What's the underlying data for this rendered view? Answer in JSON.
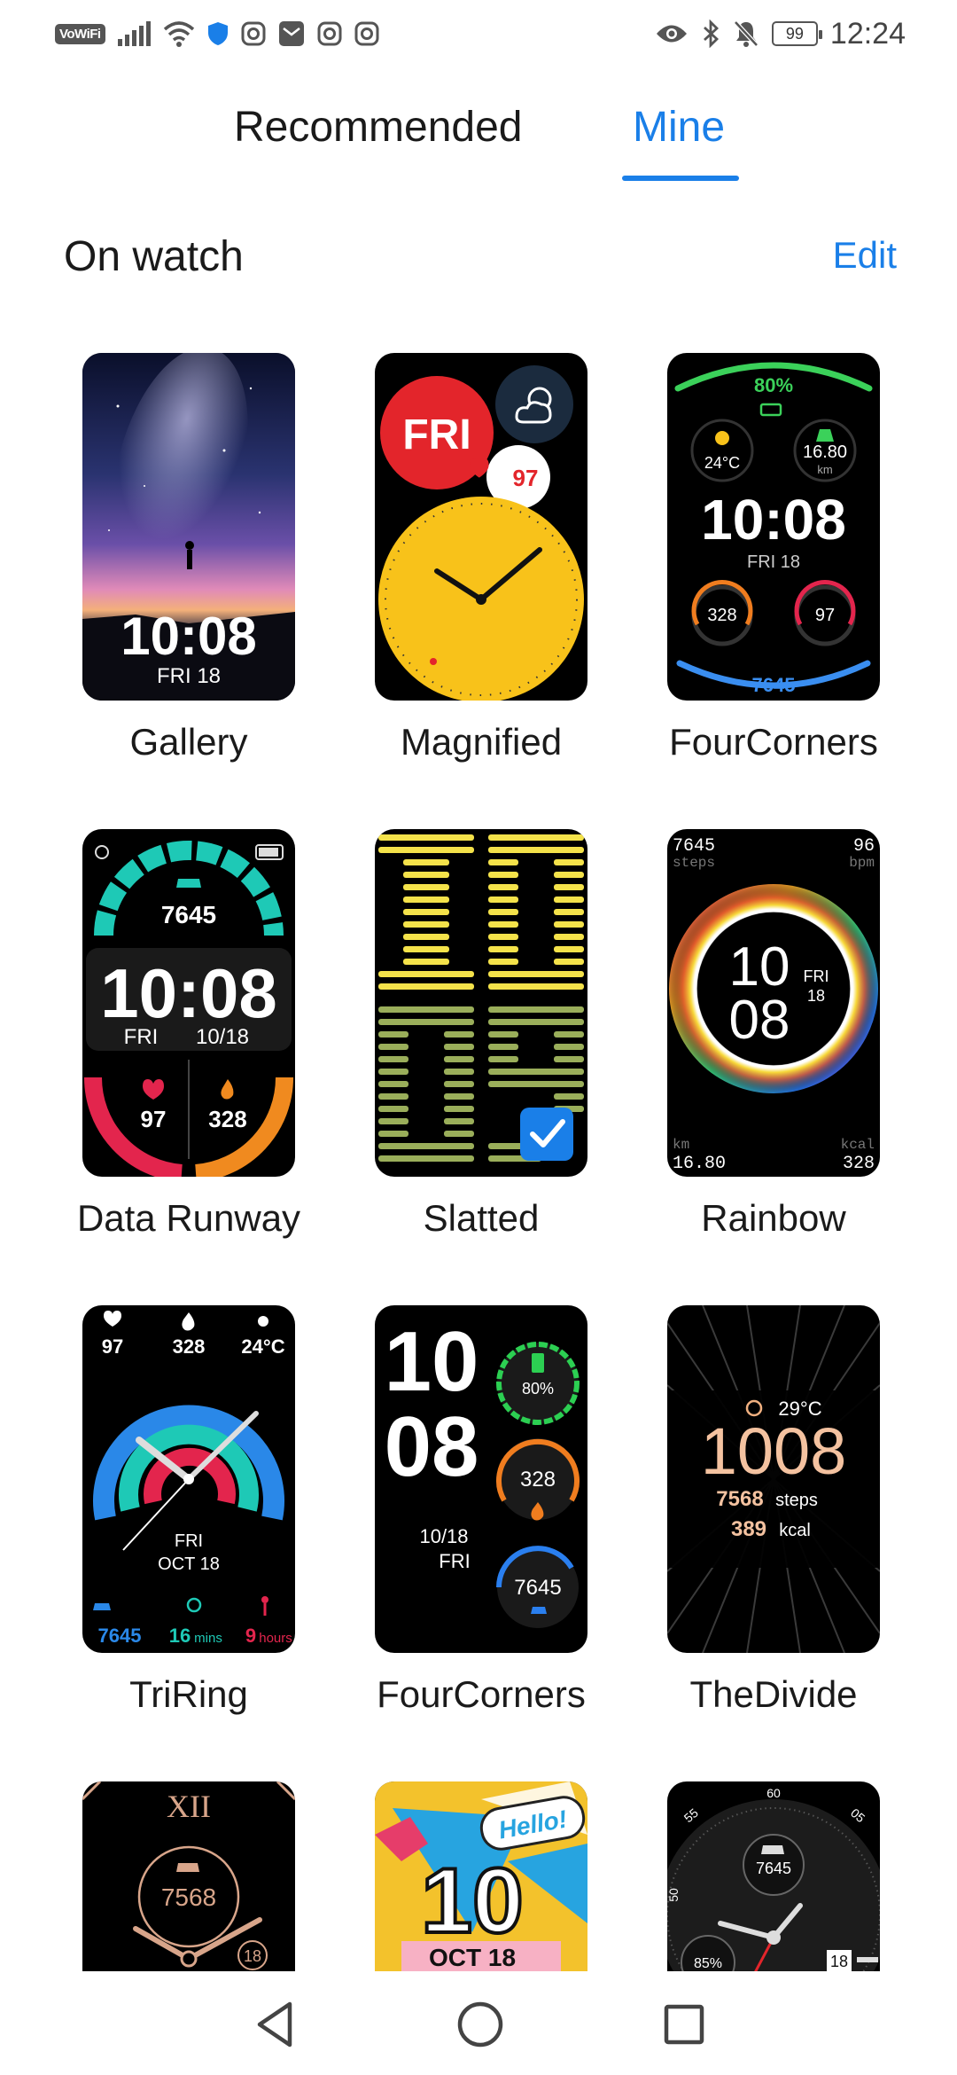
{
  "status_bar": {
    "vowifi": "VoWiFi",
    "battery": "99",
    "time": "12:24"
  },
  "tabs": [
    {
      "label": "Recommended",
      "active": false
    },
    {
      "label": "Mine",
      "active": true
    }
  ],
  "section": {
    "title": "On watch",
    "edit_label": "Edit"
  },
  "watch_faces": [
    {
      "name": "Gallery",
      "time": "10:08",
      "date": "FRI 18"
    },
    {
      "name": "Magnified",
      "day": "FRI",
      "heart": "97"
    },
    {
      "name": "FourCorners",
      "battery": "80%",
      "temp": "24°C",
      "distance": "16.80",
      "distance_unit": "km",
      "time": "10:08",
      "date": "FRI 18",
      "calories": "328",
      "heart": "97",
      "steps": "7645"
    },
    {
      "name": "Data Runway",
      "steps": "7645",
      "time": "10:08",
      "date_day": "FRI",
      "date": "10/18",
      "heart": "97",
      "calories": "328"
    },
    {
      "name": "Slatted",
      "selected": true
    },
    {
      "name": "Rainbow",
      "steps": "7645",
      "steps_label": "steps",
      "bpm": "96",
      "bpm_label": "bpm",
      "hour": "10",
      "minute": "08",
      "day": "FRI",
      "date": "18",
      "km_label": "km",
      "km": "16.80",
      "kcal_label": "kcal",
      "kcal": "328"
    },
    {
      "name": "TriRing",
      "heart": "97",
      "calories": "328",
      "temp": "24°C",
      "day": "FRI",
      "date": "OCT 18",
      "steps": "7645",
      "mins": "16",
      "mins_label": "mins",
      "hours": "9",
      "hours_label": "hours"
    },
    {
      "name": "FourCorners",
      "hour": "10",
      "minute": "08",
      "date": "10/18",
      "day": "FRI",
      "battery": "80%",
      "calories": "328",
      "steps": "7645"
    },
    {
      "name": "TheDivide",
      "temp": "29°C",
      "time": "1008",
      "steps": "7568",
      "steps_label": "steps",
      "kcal": "389",
      "kcal_label": "kcal"
    },
    {
      "name": "",
      "numeral": "XII",
      "steps": "7568",
      "date": "18"
    },
    {
      "name": "",
      "hello": "Hello!",
      "number": "10",
      "date": "OCT 18"
    },
    {
      "name": "",
      "steps": "7645",
      "battery": "85%",
      "date": "18",
      "ticks": [
        "60",
        "55",
        "05",
        "50"
      ]
    }
  ],
  "colors": {
    "accent": "#1a7fe8",
    "text": "#1a1a1a"
  }
}
